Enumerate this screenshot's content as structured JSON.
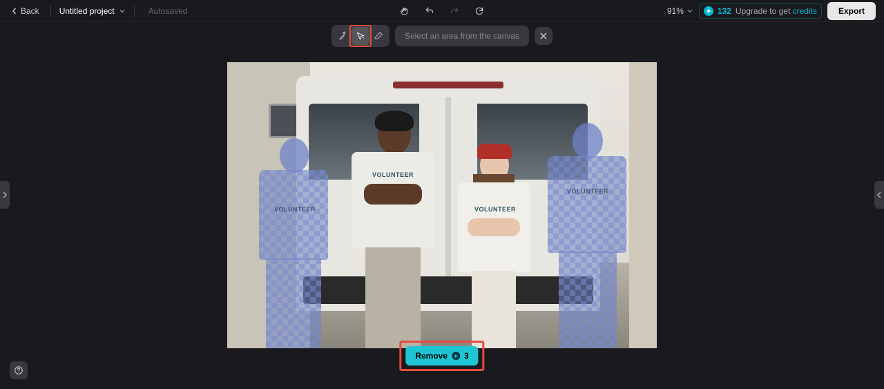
{
  "topbar": {
    "back_label": "Back",
    "project_name": "Untitled project",
    "autosaved_label": "Autosaved",
    "zoom_value": "91%",
    "credits_value": "132",
    "upgrade_prefix": "Upgrade to get ",
    "upgrade_credits_word": "credits",
    "export_label": "Export"
  },
  "tools": {
    "prompt_text": "Select an area from the canvas"
  },
  "action": {
    "remove_label": "Remove",
    "remove_cost": "3"
  },
  "canvas": {
    "shirt_text": "VOLUNTEER"
  }
}
